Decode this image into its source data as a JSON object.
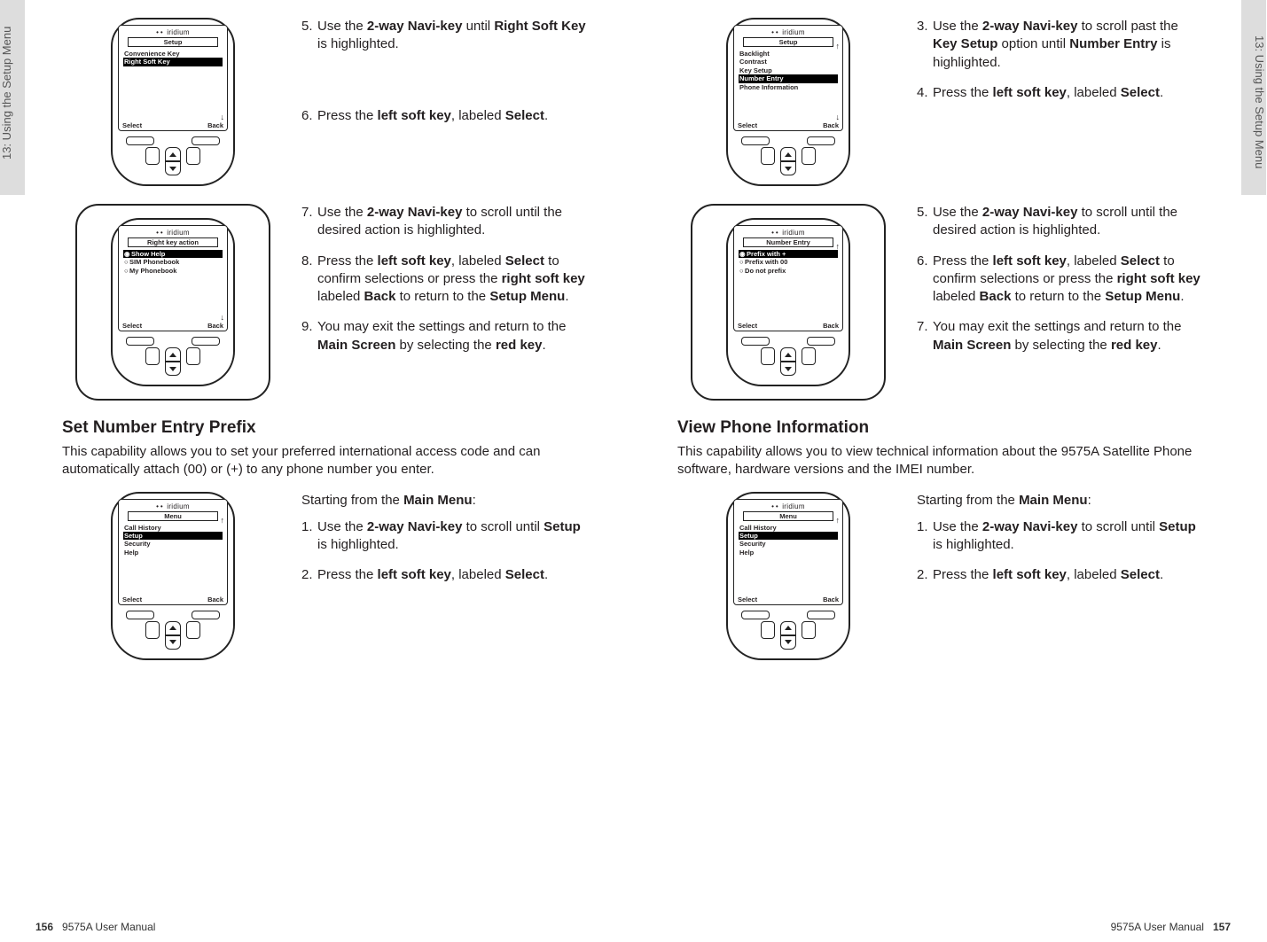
{
  "chapter_tab": "13: Using the Setup Menu",
  "footer_manual": "9575A User Manual",
  "page_left_num": "156",
  "page_right_num": "157",
  "brand": "iridium",
  "leftPage": {
    "phone1": {
      "screen_title": "Setup",
      "items": [
        "Convenience Key"
      ],
      "highlight": "Right Soft Key",
      "soft_left": "Select",
      "soft_right": "Back"
    },
    "step5": {
      "num": "5.",
      "text_a": "Use the ",
      "b1": "2-way Navi-key",
      "text_b": " until ",
      "b2": "Right Soft Key",
      "text_c": " is highlighted."
    },
    "step6": {
      "num": "6.",
      "text_a": "Press the ",
      "b1": "left soft key",
      "text_b": ", labeled ",
      "b2": "Select",
      "text_c": "."
    },
    "phone2": {
      "screen_title": "Right key action",
      "opt_sel": "Show Help",
      "opt2": "SIM Phonebook",
      "opt3": "My Phonebook",
      "soft_left": "Select",
      "soft_right": "Back"
    },
    "step7": {
      "num": "7.",
      "text_a": "Use the ",
      "b1": "2-way Navi-key",
      "text_b": " to scroll until the desired action is highlighted."
    },
    "step8": {
      "num": "8.",
      "text_a": "Press the ",
      "b1": "left soft key",
      "text_b": ", labeled ",
      "b2": "Select",
      "text_c": " to confirm selections or press the ",
      "b3": "right soft key",
      "text_d": " labeled ",
      "b4": "Back",
      "text_e": " to return to the ",
      "b5": "Setup Menu",
      "text_f": "."
    },
    "step9": {
      "num": "9.",
      "text_a": "You may exit the settings and return to the ",
      "b1": "Main Screen",
      "text_b": " by selecting the ",
      "b2": "red key",
      "text_c": "."
    },
    "section_title": "Set Number Entry Prefix",
    "section_desc": "This capability allows you to set your preferred international access code and can automatically attach (00) or (+) to any phone number you enter.",
    "starting": "Starting from the ",
    "starting_b": "Main Menu",
    "starting_c": ":",
    "phone3": {
      "screen_title": "Menu",
      "items": [
        "Call History"
      ],
      "highlight": "Setup",
      "items2": [
        "Security",
        "Help"
      ],
      "soft_left": "Select",
      "soft_right": "Back"
    },
    "step1": {
      "num": "1.",
      "text_a": "Use the ",
      "b1": "2-way Navi-key",
      "text_b": " to scroll until ",
      "b2": "Setup",
      "text_c": " is highlighted."
    },
    "step2": {
      "num": "2.",
      "text_a": "Press the ",
      "b1": "left soft key",
      "text_b": ", labeled ",
      "b2": "Select",
      "text_c": "."
    }
  },
  "rightPage": {
    "phone1": {
      "screen_title": "Setup",
      "items": [
        "Backlight",
        "Contrast",
        "Key Setup"
      ],
      "highlight": "Number Entry",
      "items2": [
        "Phone Information"
      ],
      "soft_left": "Select",
      "soft_right": "Back"
    },
    "step3": {
      "num": "3.",
      "text_a": "Use the ",
      "b1": "2-way Navi-key",
      "text_b": " to scroll past the ",
      "b2": "Key Setup",
      "text_c": " option until ",
      "b3": "Number Entry",
      "text_d": " is highlighted."
    },
    "step4": {
      "num": "4.",
      "text_a": "Press the ",
      "b1": "left soft key",
      "text_b": ", labeled ",
      "b2": "Select",
      "text_c": "."
    },
    "phone2": {
      "screen_title": "Number Entry",
      "opt_sel": "Prefix with +",
      "opt2": "Prefix with 00",
      "opt3": "Do not prefix",
      "soft_left": "Select",
      "soft_right": "Back"
    },
    "step5": {
      "num": "5.",
      "text_a": "Use the ",
      "b1": "2-way Navi-key",
      "text_b": " to scroll until the desired action is highlighted."
    },
    "step6": {
      "num": "6.",
      "text_a": "Press the ",
      "b1": "left soft key",
      "text_b": ", labeled ",
      "b2": "Select",
      "text_c": " to confirm selections or press the ",
      "b3": "right soft key",
      "text_d": " labeled ",
      "b4": "Back",
      "text_e": " to return to the ",
      "b5": "Setup Menu",
      "text_f": "."
    },
    "step7": {
      "num": "7.",
      "text_a": "You may exit the settings and return to the ",
      "b1": "Main Screen",
      "text_b": " by selecting the ",
      "b2": "red key",
      "text_c": "."
    },
    "section_title": "View Phone Information",
    "section_desc": "This capability allows you to view technical information about the 9575A Satellite Phone software, hardware versions and the IMEI number.",
    "starting": "Starting from the ",
    "starting_b": "Main Menu",
    "starting_c": ":",
    "phone3": {
      "screen_title": "Menu",
      "items": [
        "Call History"
      ],
      "highlight": "Setup",
      "items2": [
        "Security",
        "Help"
      ],
      "soft_left": "Select",
      "soft_right": "Back"
    },
    "step1": {
      "num": "1.",
      "text_a": "Use the ",
      "b1": "2-way Navi-key",
      "text_b": " to scroll until ",
      "b2": "Setup",
      "text_c": " is highlighted."
    },
    "step2": {
      "num": "2.",
      "text_a": "Press the ",
      "b1": "left soft key",
      "text_b": ", labeled ",
      "b2": "Select",
      "text_c": "."
    }
  }
}
